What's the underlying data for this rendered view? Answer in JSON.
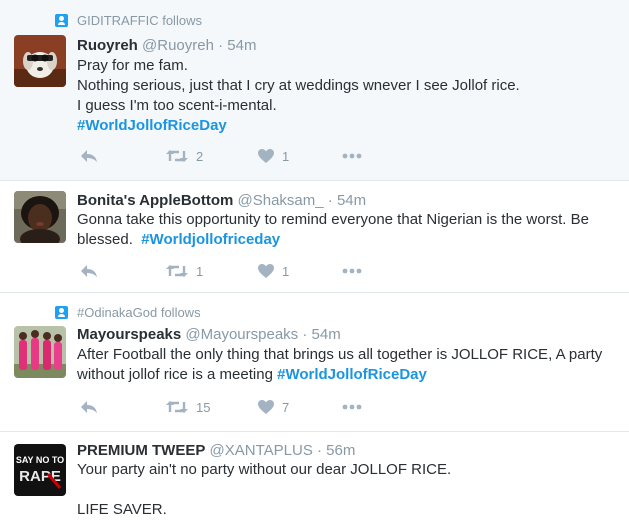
{
  "tweets": [
    {
      "context": "GIDITRAFFIC follows",
      "name": "Ruoyreh",
      "handle": "@Ruoyreh",
      "separator": "·",
      "time": "54m",
      "lines": [
        "Pray for me fam.",
        "Nothing serious, just that I cry at weddings wnever I see Jollof rice.",
        "I guess I'm too scent-i-mental."
      ],
      "hashtag": "#WorldJollofRiceDay",
      "retweets": "2",
      "likes": "1"
    },
    {
      "name": "Bonita's AppleBottom",
      "handle": "@Shaksam_",
      "separator": "·",
      "time": "54m",
      "line1": "Gonna take this opportunity to remind everyone that Nigerian is the worst. Be",
      "line2": "blessed.",
      "hashtag": "#Worldjollofriceday",
      "retweets": "1",
      "likes": "1"
    },
    {
      "context": "#OdinakaGod follows",
      "name": "Mayourspeaks",
      "handle": "@Mayourspeaks",
      "separator": "·",
      "time": "54m",
      "line1": "After Football the only thing that brings us all together is JOLLOF RICE, A party",
      "line2": "without jollof rice is a meeting",
      "hashtag": "#WorldJollofRiceDay",
      "retweets": "15",
      "likes": "7"
    },
    {
      "name": "PREMIUM TWEEP",
      "handle": "@XANTAPLUS",
      "separator": "·",
      "time": "56m",
      "lines": [
        "Your party ain't no party without our dear JOLLOF RICE.",
        "LIFE SAVER."
      ],
      "avatar_text": [
        "SAY NO TO",
        "RAPE"
      ]
    }
  ]
}
